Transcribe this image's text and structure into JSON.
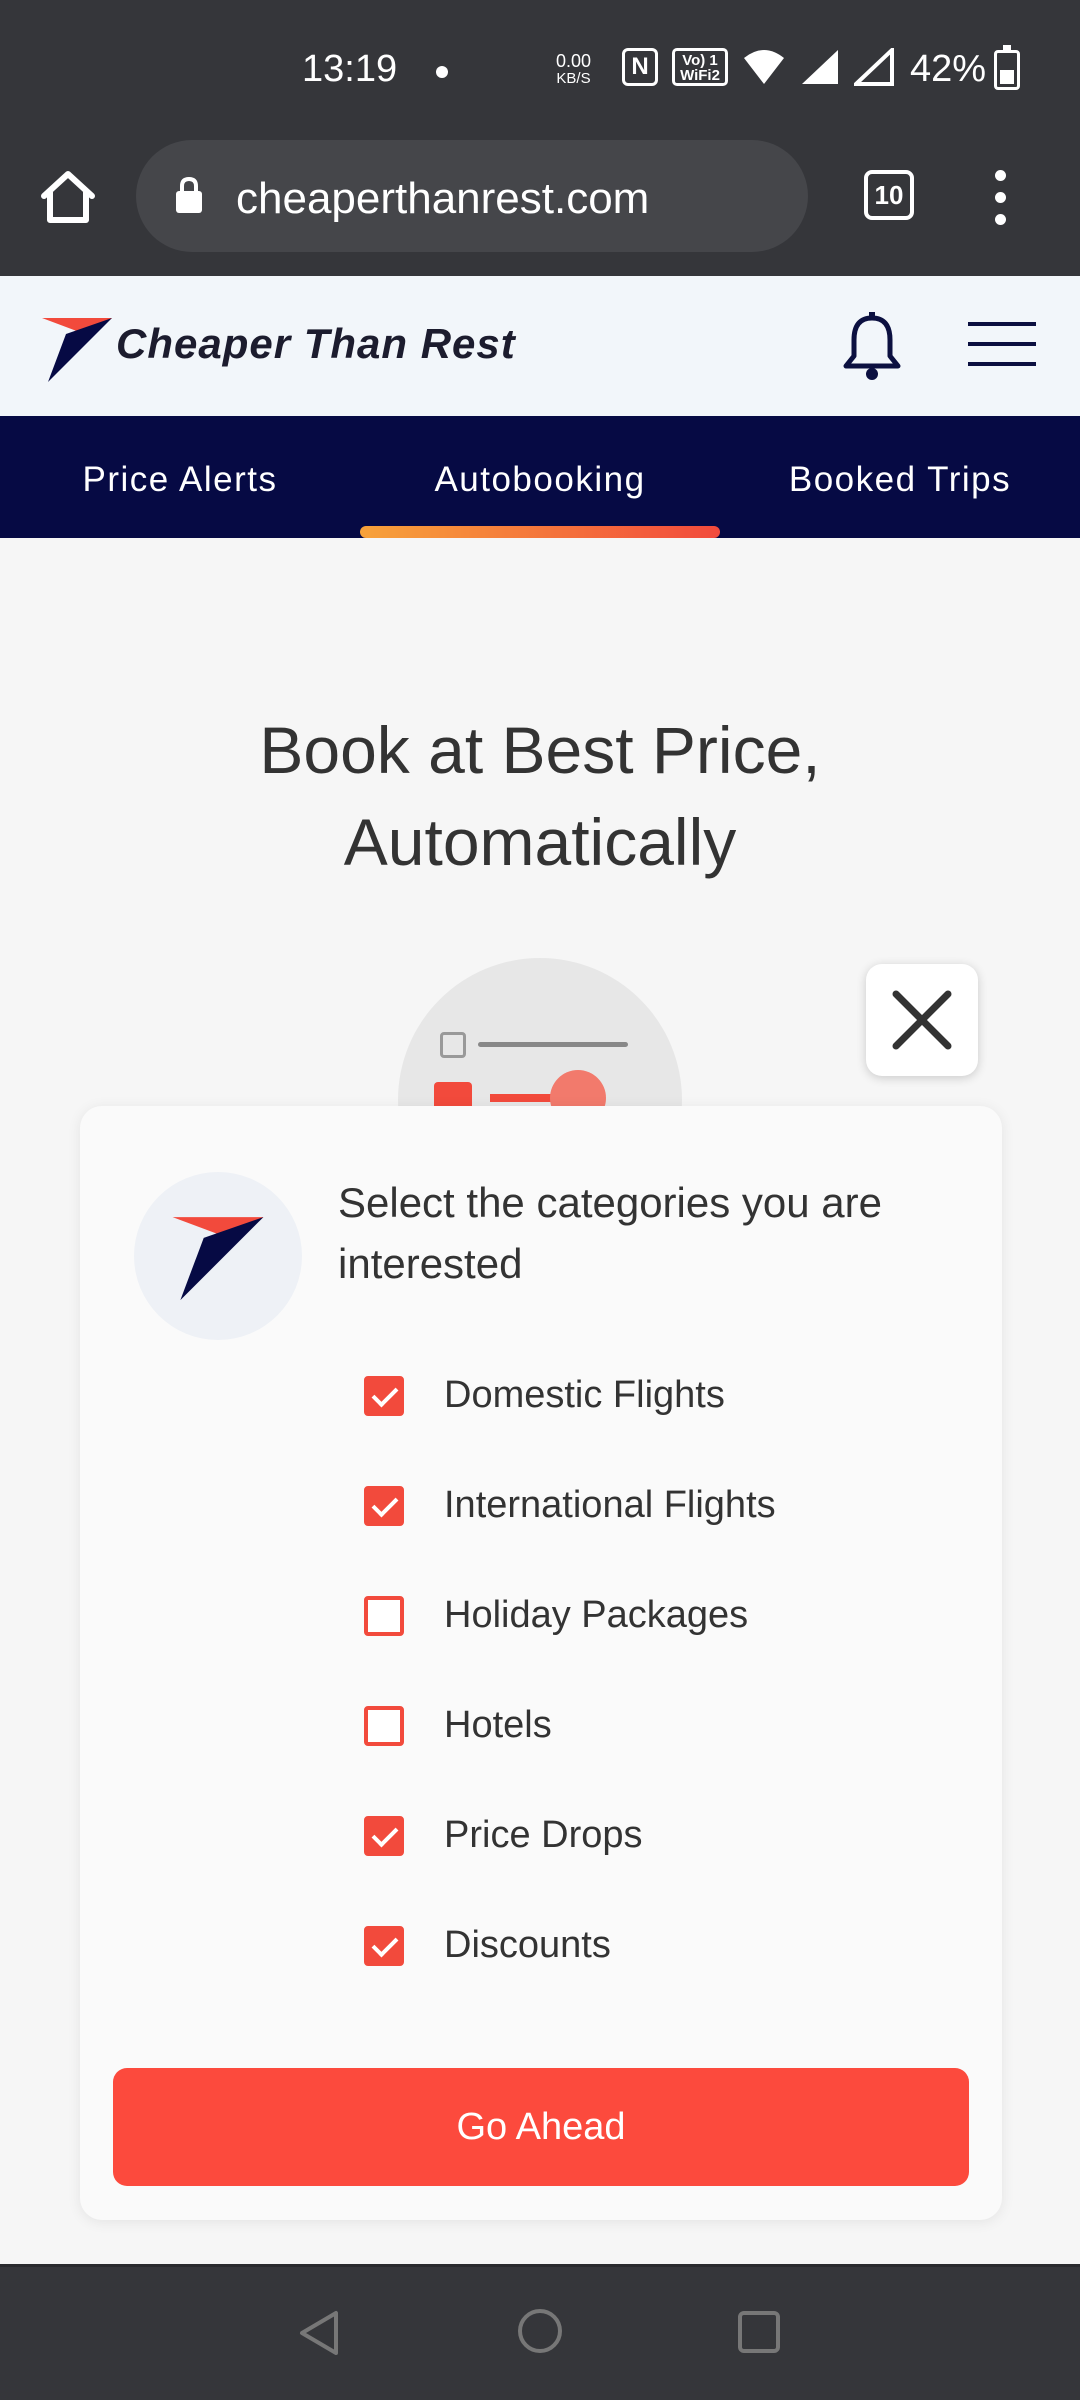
{
  "status_bar": {
    "time": "13:19",
    "speed_value": "0.00",
    "speed_unit": "KB/S",
    "nfc": "N",
    "wifi_call": "Vo) 1 WiFi2",
    "battery": "42%"
  },
  "browser": {
    "url": "cheaperthanrest.com",
    "tab_count": "10"
  },
  "site": {
    "name": "Cheaper Than Rest",
    "brand_colors": {
      "navy": "#060a44",
      "red": "#f24a3c",
      "orange": "#f7a23a"
    }
  },
  "tabs": [
    {
      "label": "Price Alerts",
      "active": false
    },
    {
      "label": "Autobooking",
      "active": true
    },
    {
      "label": "Booked Trips",
      "active": false
    }
  ],
  "hero": {
    "title": "Book at Best Price, Automatically"
  },
  "modal": {
    "heading": "Select the categories you are interested",
    "categories": [
      {
        "label": "Domestic Flights",
        "checked": true
      },
      {
        "label": "International Flights",
        "checked": true
      },
      {
        "label": "Holiday Packages",
        "checked": false
      },
      {
        "label": "Hotels",
        "checked": false
      },
      {
        "label": "Price Drops",
        "checked": true
      },
      {
        "label": "Discounts",
        "checked": true
      }
    ],
    "submit_label": "Go Ahead"
  },
  "icons": {
    "home": "home-icon",
    "lock": "lock-icon",
    "tabs": "tabs-icon",
    "menu": "more-vert-icon",
    "bell": "bell-icon",
    "hamburger": "hamburger-icon",
    "close": "close-icon",
    "back": "back-triangle-icon",
    "nav_home": "circle-home-icon",
    "recents": "square-recents-icon"
  }
}
